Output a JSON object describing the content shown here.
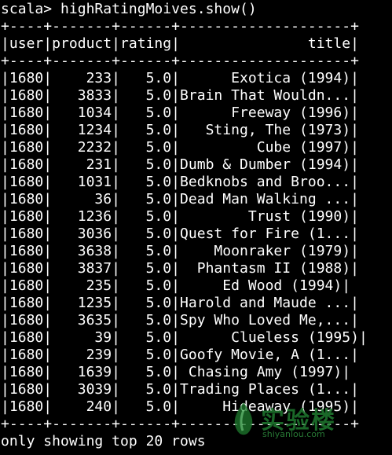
{
  "terminal": {
    "prompt_line": "scala> highRatingMoives.show()",
    "border_line": "+----+-------+------+--------------------+",
    "header_line": "|user|product|rating|               title|",
    "rows": [
      "|1680|    233|   5.0|      Exotica (1994)|",
      "|1680|   3833|   5.0|Brain That Wouldn...|",
      "|1680|   1034|   5.0|      Freeway (1996)|",
      "|1680|   1234|   5.0|   Sting, The (1973)|",
      "|1680|   2232|   5.0|         Cube (1997)|",
      "|1680|    231|   5.0|Dumb & Dumber (1994)|",
      "|1680|   1031|   5.0|Bedknobs and Broo...|",
      "|1680|     36|   5.0|Dead Man Walking ...|",
      "|1680|   1236|   5.0|        Trust (1990)|",
      "|1680|   3036|   5.0|Quest for Fire (1...|",
      "|1680|   3638|   5.0|    Moonraker (1979)|",
      "|1680|   3837|   5.0|  Phantasm II (1988)|",
      "|1680|    235|   5.0|     Ed Wood (1994)|",
      "|1680|   1235|   5.0|Harold and Maude ...|",
      "|1680|   3635|   5.0|Spy Who Loved Me,...|",
      "|1680|     39|   5.0|      Clueless (1995)|",
      "|1680|    239|   5.0|Goofy Movie, A (1...|",
      "|1680|   1639|   5.0| Chasing Amy (1997)|",
      "|1680|   3039|   5.0|Trading Places (1...|",
      "|1680|    240|   5.0|     Hideaway (1995)|"
    ],
    "footer_line": "only showing top 20 rows"
  },
  "watermark": {
    "brand_text": "实验楼",
    "url_text": "shiyanlou.com",
    "icon": "leaf-drop-icon"
  },
  "colors": {
    "background": "#000000",
    "foreground": "#ffffff",
    "watermark_green": "#1f7a2f"
  }
}
